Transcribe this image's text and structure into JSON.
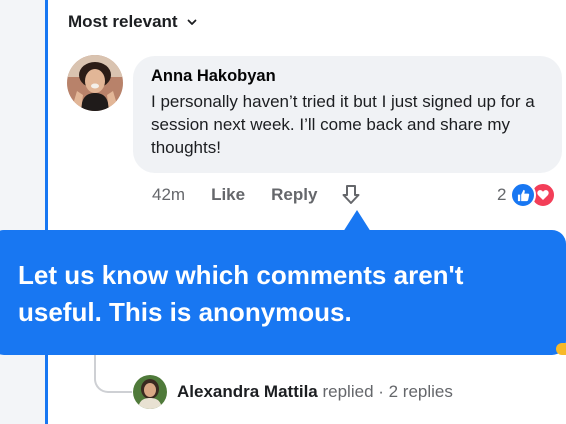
{
  "sort": {
    "label": "Most relevant"
  },
  "comment": {
    "author": "Anna Hakobyan",
    "text": "I personally haven’t tried it but I just signed up for a session next week. I’ll come back and share my thoughts!",
    "time": "42m",
    "like_label": "Like",
    "reply_label": "Reply",
    "reaction_count": "2",
    "reactions": [
      "like",
      "love"
    ]
  },
  "tooltip": {
    "text": "Let us know which comments aren't useful. This is anonymous."
  },
  "replies": {
    "name": "Alexandra Mattila",
    "summary": " replied · 2 replies"
  },
  "colors": {
    "accent": "#1877f2",
    "love": "#f33e58",
    "bubble": "#f0f2f5",
    "secondary_text": "#65676b"
  }
}
